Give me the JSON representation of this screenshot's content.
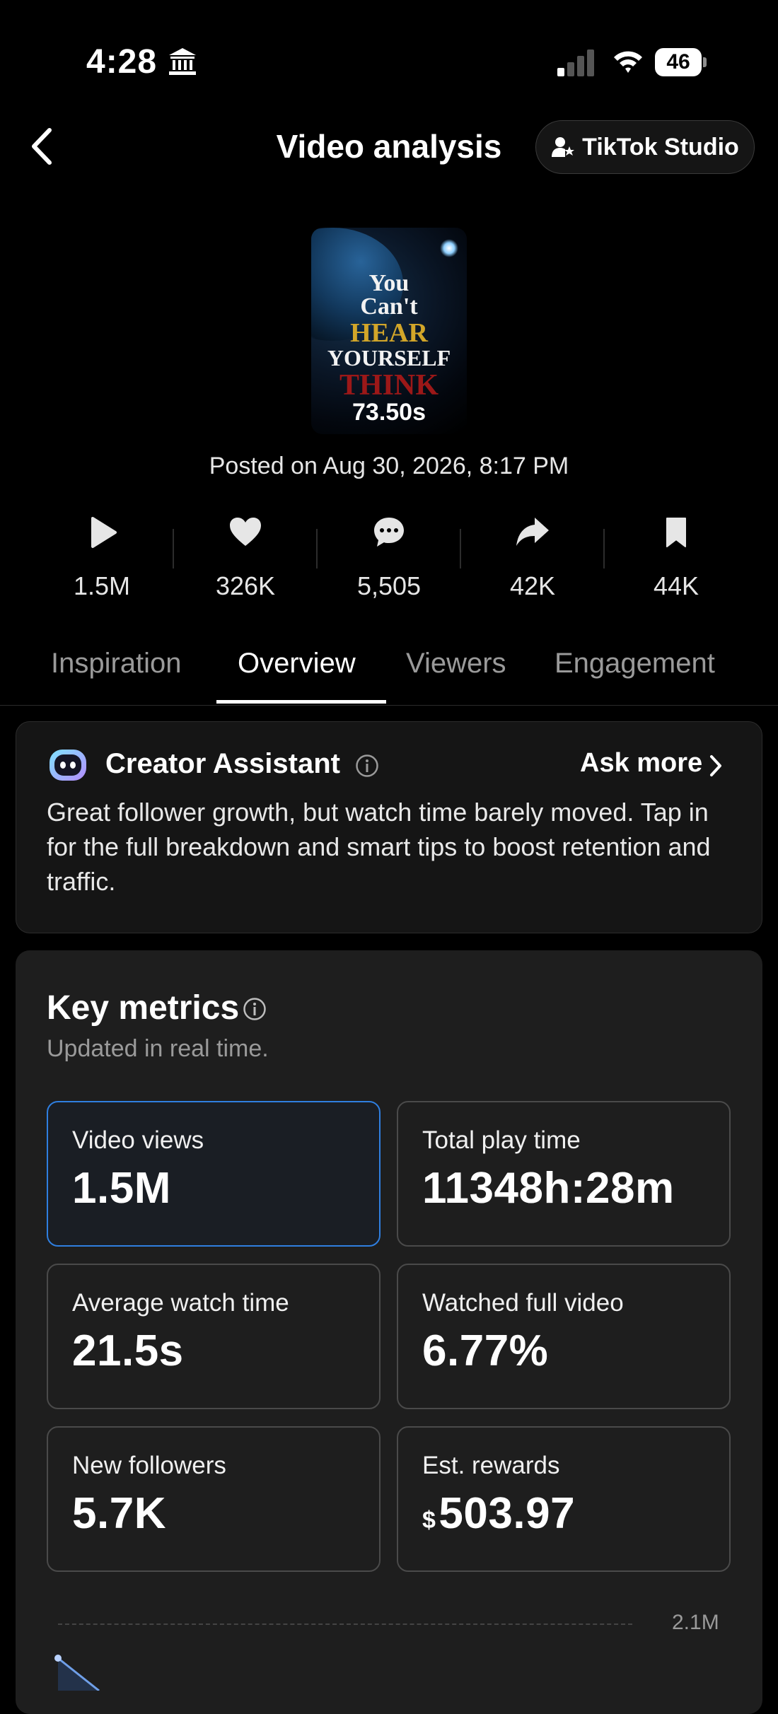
{
  "status_bar": {
    "time": "4:28",
    "battery": "46"
  },
  "header": {
    "title": "Video analysis",
    "studio_button": "TikTok Studio"
  },
  "video": {
    "thumbnail_text": [
      "You",
      "Can't",
      "HEAR",
      "YOURSELF",
      "THINK"
    ],
    "duration": "73.50s",
    "posted": "Posted on Aug 30, 2026, 8:17 PM"
  },
  "stats": [
    {
      "icon": "play-icon",
      "value": "1.5M"
    },
    {
      "icon": "heart-icon",
      "value": "326K"
    },
    {
      "icon": "comment-icon",
      "value": "5,505"
    },
    {
      "icon": "share-icon",
      "value": "42K"
    },
    {
      "icon": "bookmark-icon",
      "value": "44K"
    }
  ],
  "tabs": [
    {
      "label": "Inspiration"
    },
    {
      "label": "Overview"
    },
    {
      "label": "Viewers"
    },
    {
      "label": "Engagement"
    }
  ],
  "active_tab": "Overview",
  "assistant": {
    "title": "Creator Assistant",
    "ask_more": "Ask more",
    "text": "Great follower growth, but watch time barely moved. Tap in for the full breakdown and smart tips to boost retention and traffic."
  },
  "key_metrics": {
    "title": "Key metrics",
    "subtitle": "Updated in real time.",
    "tiles": [
      {
        "label": "Video views",
        "value": "1.5M",
        "selected": true
      },
      {
        "label": "Total play time",
        "value": "11348h:28m"
      },
      {
        "label": "Average watch time",
        "value": "21.5s"
      },
      {
        "label": "Watched full video",
        "value": "6.77%"
      },
      {
        "label": "New followers",
        "value": "5.7K"
      },
      {
        "label": "Est. rewards",
        "currency": "$",
        "value": "503.97"
      }
    ]
  },
  "chart": {
    "max_label": "2.1M"
  },
  "colors": {
    "accent": "#2f7fe0",
    "assistant_icon": "#a8b8ff"
  }
}
